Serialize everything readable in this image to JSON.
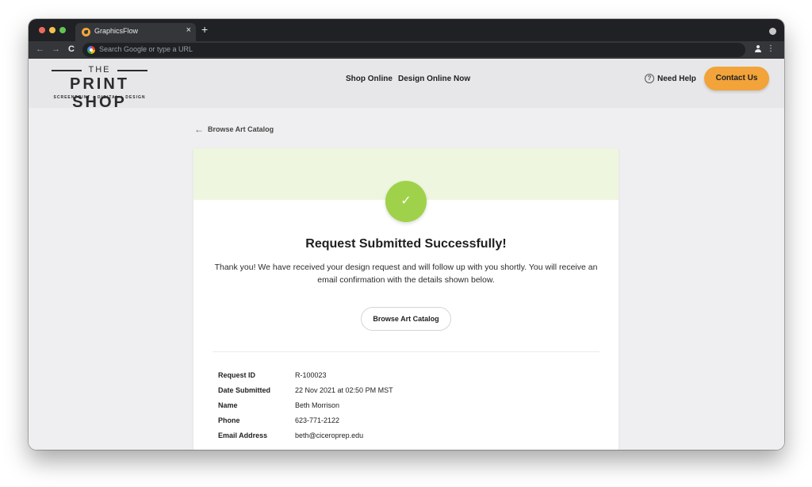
{
  "browser": {
    "tab_title": "GraphicsFlow",
    "tab_close": "×",
    "new_tab": "+",
    "back": "←",
    "forward": "→",
    "reload": "C",
    "address_placeholder": "Search Google or type a URL",
    "menu": "⋮",
    "traffic_lights": [
      "#ed6a5e",
      "#f5bf4f",
      "#61c554"
    ]
  },
  "header": {
    "logo": {
      "top": "THE",
      "main": "PRINT SHOP",
      "sub": "SCREENPRINT + DIGITAL + DESIGN"
    },
    "nav": [
      "Shop Online",
      "Design Online Now"
    ],
    "help_icon": "?",
    "help_label": "Need Help",
    "contact_label": "Contact Us"
  },
  "main": {
    "back_arrow": "←",
    "back_label": "Browse Art Catalog",
    "check_icon": "✓",
    "title": "Request Submitted Successfully!",
    "message": "Thank you! We have received your design request and will follow up with you shortly. You will receive an email confirmation with the details shown below.",
    "button_label": "Browse Art Catalog",
    "details": [
      {
        "label": "Request ID",
        "value": "R-100023"
      },
      {
        "label": "Date Submitted",
        "value": "22 Nov 2021 at 02:50 PM MST"
      },
      {
        "label": "Name",
        "value": "Beth Morrison"
      },
      {
        "label": "Phone",
        "value": "623-771-2122"
      },
      {
        "label": "Email Address",
        "value": "beth@ciceroprep.edu"
      }
    ]
  },
  "colors": {
    "accent": "#f2a33a",
    "success": "#9fd24a",
    "success_band": "#eef6df"
  }
}
